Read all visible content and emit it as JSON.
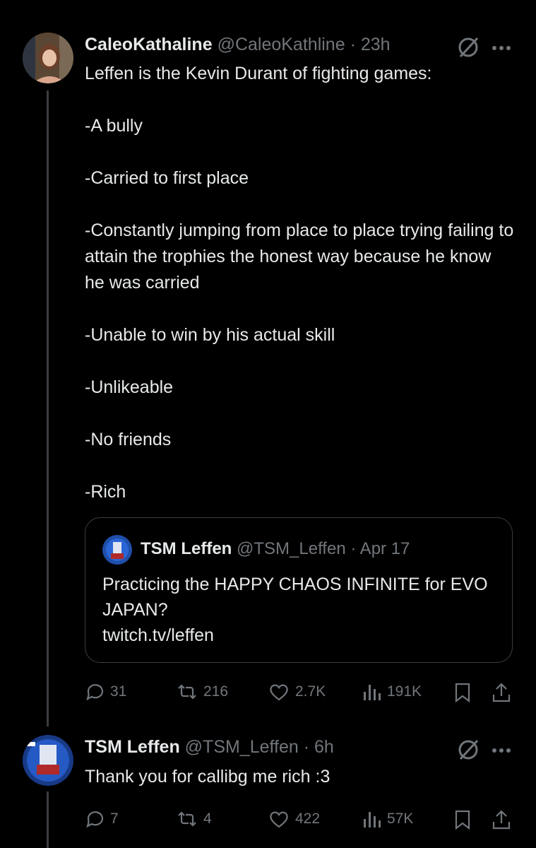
{
  "tweet1": {
    "display_name": "CaleoKathaline",
    "handle": "@CaleoKathline",
    "time": "· 23h",
    "text": "Leffen is the Kevin Durant of fighting games:\n\n-A bully\n\n-Carried to first place\n\n-Constantly jumping from place to place trying failing to attain the trophies the honest way because he know he was carried\n\n-Unable to win by his actual skill\n\n-Unlikeable\n\n-No friends\n\n-Rich",
    "quote": {
      "display_name": "TSM Leffen",
      "handle": "@TSM_Leffen",
      "time": "· Apr 17",
      "text": "Practicing the HAPPY CHAOS INFINITE for EVO JAPAN?\ntwitch.tv/leffen"
    },
    "actions": {
      "replies": "31",
      "reposts": "216",
      "likes": "2.7K",
      "views": "191K"
    }
  },
  "tweet2": {
    "display_name": "TSM Leffen",
    "handle": "@TSM_Leffen",
    "time": "· 6h",
    "text": "Thank you for callibg me rich :3",
    "actions": {
      "replies": "7",
      "reposts": "4",
      "likes": "422",
      "views": "57K"
    }
  },
  "icons": [
    "grok-icon",
    "more-icon",
    "reply-icon",
    "repost-icon",
    "like-icon",
    "views-icon",
    "bookmark-icon",
    "share-icon"
  ],
  "colors": {
    "background": "#000000",
    "text": "#e7e9ea",
    "muted": "#71767b",
    "border": "#3a3d40"
  }
}
